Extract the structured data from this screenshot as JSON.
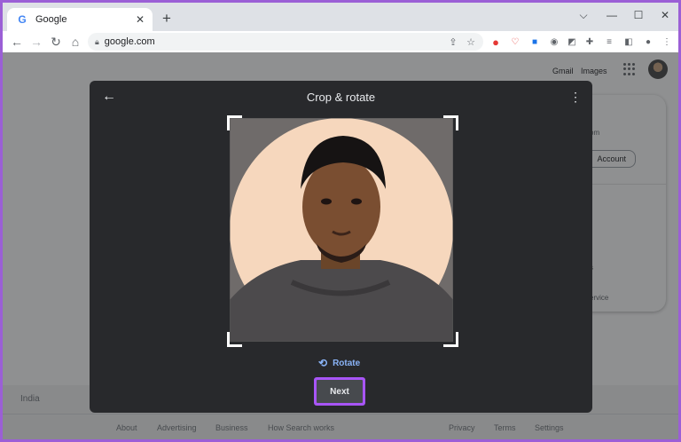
{
  "browser": {
    "tab": {
      "title": "Google",
      "favicon": "G"
    },
    "newtab_symbol": "+",
    "controls": {
      "chevron": "⌵",
      "minimize": "—",
      "maximize": "☐",
      "close": "✕"
    },
    "url": "google.com"
  },
  "page": {
    "header": {
      "gmail": "Gmail",
      "images": "Images"
    },
    "account_card": {
      "email_tail": "om",
      "manage_label": "Account",
      "service_tail": "ervice",
      "other_tail": "s"
    },
    "footer": {
      "country": "India",
      "left_links": [
        "About",
        "Advertising",
        "Business",
        "How Search works"
      ],
      "right_links": [
        "Privacy",
        "Terms",
        "Settings"
      ]
    }
  },
  "dialog": {
    "title": "Crop & rotate",
    "rotate_label": "Rotate",
    "next_label": "Next"
  },
  "colors": {
    "accent": "#8ab4f8",
    "highlight": "#a855f7",
    "dialog_bg": "#28292c"
  }
}
